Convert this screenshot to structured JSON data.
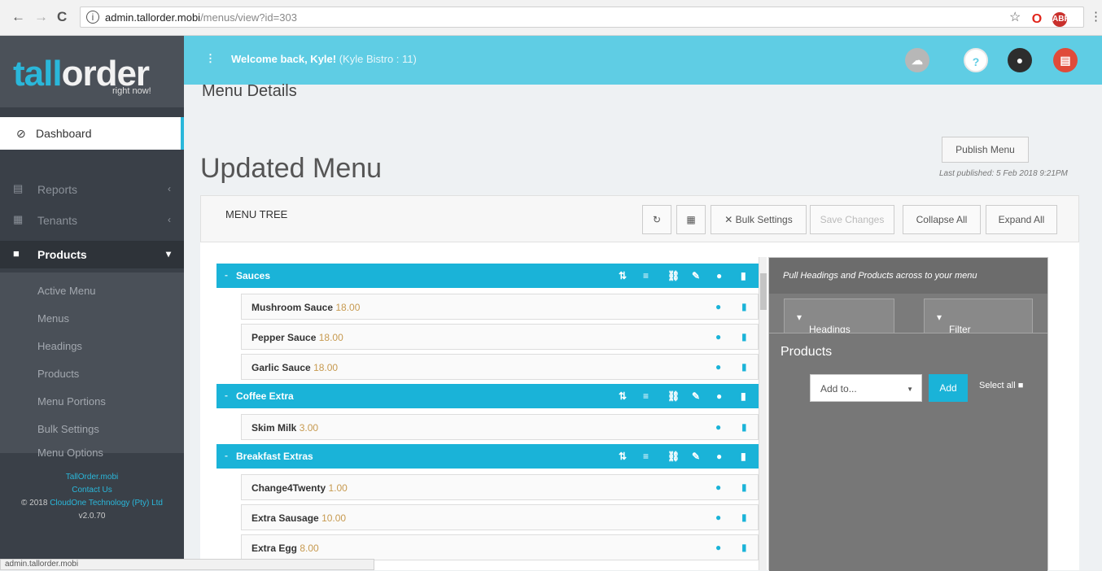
{
  "browser": {
    "url_host": "admin.tallorder.mobi",
    "url_path": "/menus/view?id=303",
    "status_url": "admin.tallorder.mobi"
  },
  "sidebar": {
    "logo_word_a": "ta",
    "logo_word_b": "ll",
    "logo_word_c": "order",
    "logo_sub": "right now!",
    "dashboard": "Dashboard",
    "items": [
      {
        "label": "Reports"
      },
      {
        "label": "Tenants"
      },
      {
        "label": "Products"
      }
    ],
    "submenu": [
      "Active Menu",
      "Menus",
      "Headings",
      "Products",
      "Menu Portions",
      "Bulk Settings",
      "Menu Options"
    ],
    "footer": {
      "link1": "TallOrder.mobi",
      "link2": "Contact Us",
      "copy": "© 2018",
      "company": "CloudOne Technology (Pty) Ltd",
      "version": "v2.0.70"
    }
  },
  "topbar": {
    "welcome": "Welcome back, Kyle!",
    "venue": "(Kyle Bistro : 11)"
  },
  "page": {
    "title": "Menu Details",
    "heading": "Updated Menu",
    "publish_button": "Publish Menu",
    "last_published": "Last published: 5 Feb 2018 9:21PM"
  },
  "tree_toolbar": {
    "label": "MENU TREE",
    "bulk_settings": "Bulk Settings",
    "save_changes": "Save Changes",
    "collapse_all": "Collapse All",
    "expand_all": "Expand All"
  },
  "tree": {
    "headings": [
      {
        "name": "Sauces"
      },
      {
        "name": "Coffee Extra"
      },
      {
        "name": "Breakfast Extras"
      }
    ],
    "products": [
      {
        "name": "Mushroom Sauce",
        "price": "18.00"
      },
      {
        "name": "Pepper Sauce",
        "price": "18.00"
      },
      {
        "name": "Garlic Sauce",
        "price": "18.00"
      },
      {
        "name": "Skim Milk",
        "price": "3.00"
      },
      {
        "name": "Change4Twenty",
        "price": "1.00"
      },
      {
        "name": "Extra Sausage",
        "price": "10.00"
      },
      {
        "name": "Extra Egg",
        "price": "8.00"
      }
    ]
  },
  "panel": {
    "hint": "Pull Headings and Products across to your menu",
    "tab_headings": "Headings",
    "tab_filter": "Filter",
    "products_title": "Products",
    "add_to": "Add to...",
    "add_button": "Add",
    "select_all": "Select all"
  },
  "colors": {
    "accent": "#1ab3d8",
    "topbar": "#5fcde4",
    "sidebar": "#3a4048",
    "price": "#c79a50"
  }
}
